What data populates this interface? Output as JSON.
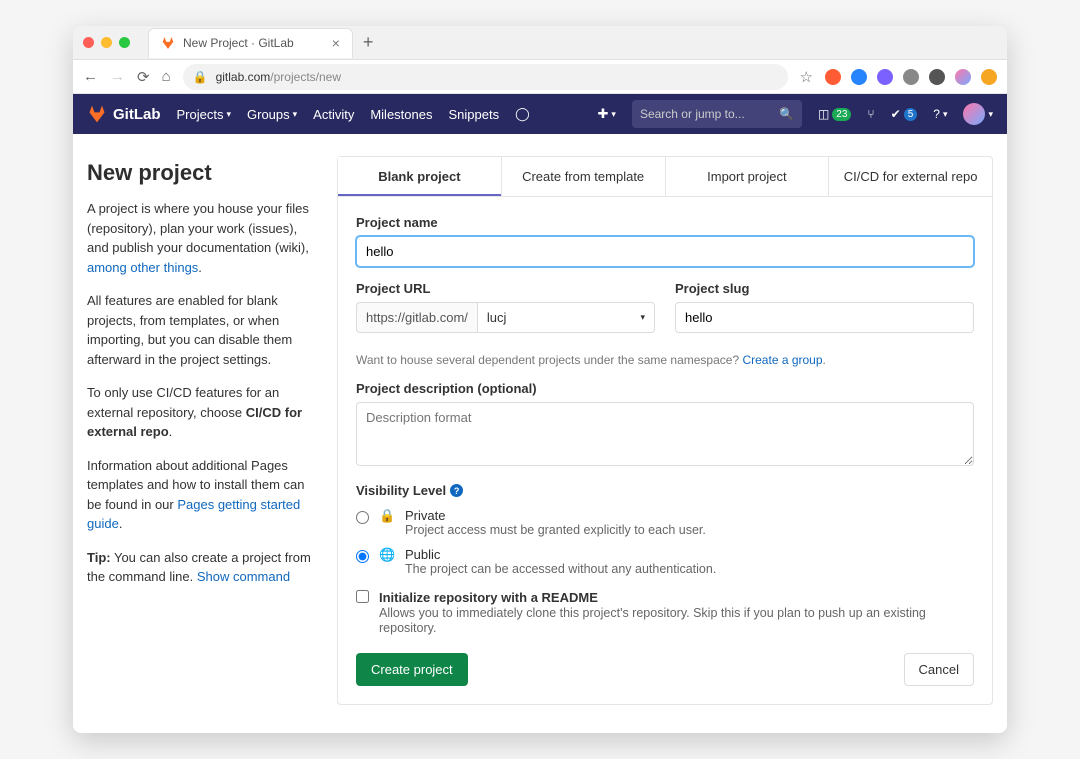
{
  "browser": {
    "tab_title": "New Project · GitLab",
    "url_host": "gitlab.com",
    "url_path": "/projects/new"
  },
  "nav": {
    "brand": "GitLab",
    "links": [
      "Projects",
      "Groups",
      "Activity",
      "Milestones",
      "Snippets"
    ],
    "search_placeholder": "Search or jump to...",
    "issues_badge": "23",
    "todos_badge": "5"
  },
  "side": {
    "title": "New project",
    "p1a": "A project is where you house your files (repository), plan your work (issues), and publish your documentation (wiki), ",
    "p1_link": "among other things",
    "p2": "All features are enabled for blank projects, from templates, or when importing, but you can disable them afterward in the project settings.",
    "p3a": "To only use CI/CD features for an external repository, choose ",
    "p3b": "CI/CD for external repo",
    "p4a": "Information about additional Pages templates and how to install them can be found in our ",
    "p4_link": "Pages getting started guide",
    "p5_tip": "Tip:",
    "p5a": " You can also create a project from the command line. ",
    "p5_link": "Show command"
  },
  "tabs": [
    "Blank project",
    "Create from template",
    "Import project",
    "CI/CD for external repo"
  ],
  "form": {
    "name_label": "Project name",
    "name_value": "hello",
    "url_label": "Project URL",
    "url_prefix": "https://gitlab.com/",
    "url_namespace": "lucj",
    "slug_label": "Project slug",
    "slug_value": "hello",
    "hint_a": "Want to house several dependent projects under the same namespace? ",
    "hint_link": "Create a group",
    "desc_label": "Project description (optional)",
    "desc_placeholder": "Description format",
    "vis_label": "Visibility Level",
    "vis": {
      "private_t": "Private",
      "private_d": "Project access must be granted explicitly to each user.",
      "public_t": "Public",
      "public_d": "The project can be accessed without any authentication."
    },
    "readme_t": "Initialize repository with a README",
    "readme_d": "Allows you to immediately clone this project's repository. Skip this if you plan to push up an existing repository.",
    "submit": "Create project",
    "cancel": "Cancel"
  }
}
